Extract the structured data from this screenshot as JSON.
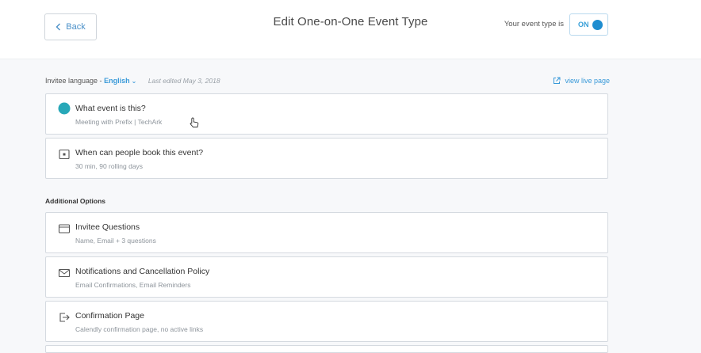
{
  "header": {
    "back_label": "Back",
    "title": "Edit One-on-One Event Type",
    "status_label": "Your event type is",
    "toggle_label": "ON"
  },
  "meta": {
    "language_label": "Invitee language -",
    "language_value": "English",
    "last_edited": "Last edited May 3, 2018",
    "view_live": "view live page"
  },
  "cards": [
    {
      "title": "What event is this?",
      "subtitle": "Meeting with Prefix | TechArk"
    },
    {
      "title": "When can people book this event?",
      "subtitle": "30 min, 90 rolling days"
    }
  ],
  "additional_options": {
    "title": "Additional Options",
    "items": [
      {
        "title": "Invitee Questions",
        "subtitle": "Name, Email + 3 questions"
      },
      {
        "title": "Notifications and Cancellation Policy",
        "subtitle": "Email Confirmations, Email Reminders"
      },
      {
        "title": "Confirmation Page",
        "subtitle": "Calendly confirmation page, no active links"
      }
    ]
  },
  "colors": {
    "accent": "#3a9ad9",
    "event_dot": "#28a8b8",
    "toggle_knob": "#1d8dd0"
  }
}
